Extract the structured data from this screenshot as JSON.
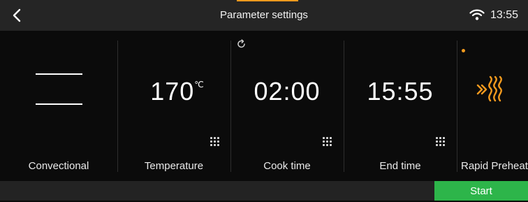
{
  "header": {
    "title": "Parameter settings",
    "time": "13:55"
  },
  "panels": {
    "mode": {
      "label": "Convectional"
    },
    "temperature": {
      "label": "Temperature",
      "value": "170",
      "unit": "℃"
    },
    "cook_time": {
      "label": "Cook time",
      "value": "02:00"
    },
    "end_time": {
      "label": "End time",
      "value": "15:55"
    },
    "rapid_preheat": {
      "label": "Rapid Preheat"
    }
  },
  "footer": {
    "start_label": "Start"
  },
  "colors": {
    "accent": "#f39a1e",
    "start": "#2db54a",
    "background": "#0b0b0b"
  },
  "icons": [
    "back-arrow-icon",
    "wifi-icon",
    "reset-icon",
    "keypad-icon",
    "preheat-heat-icon",
    "convection-mode-icon"
  ]
}
